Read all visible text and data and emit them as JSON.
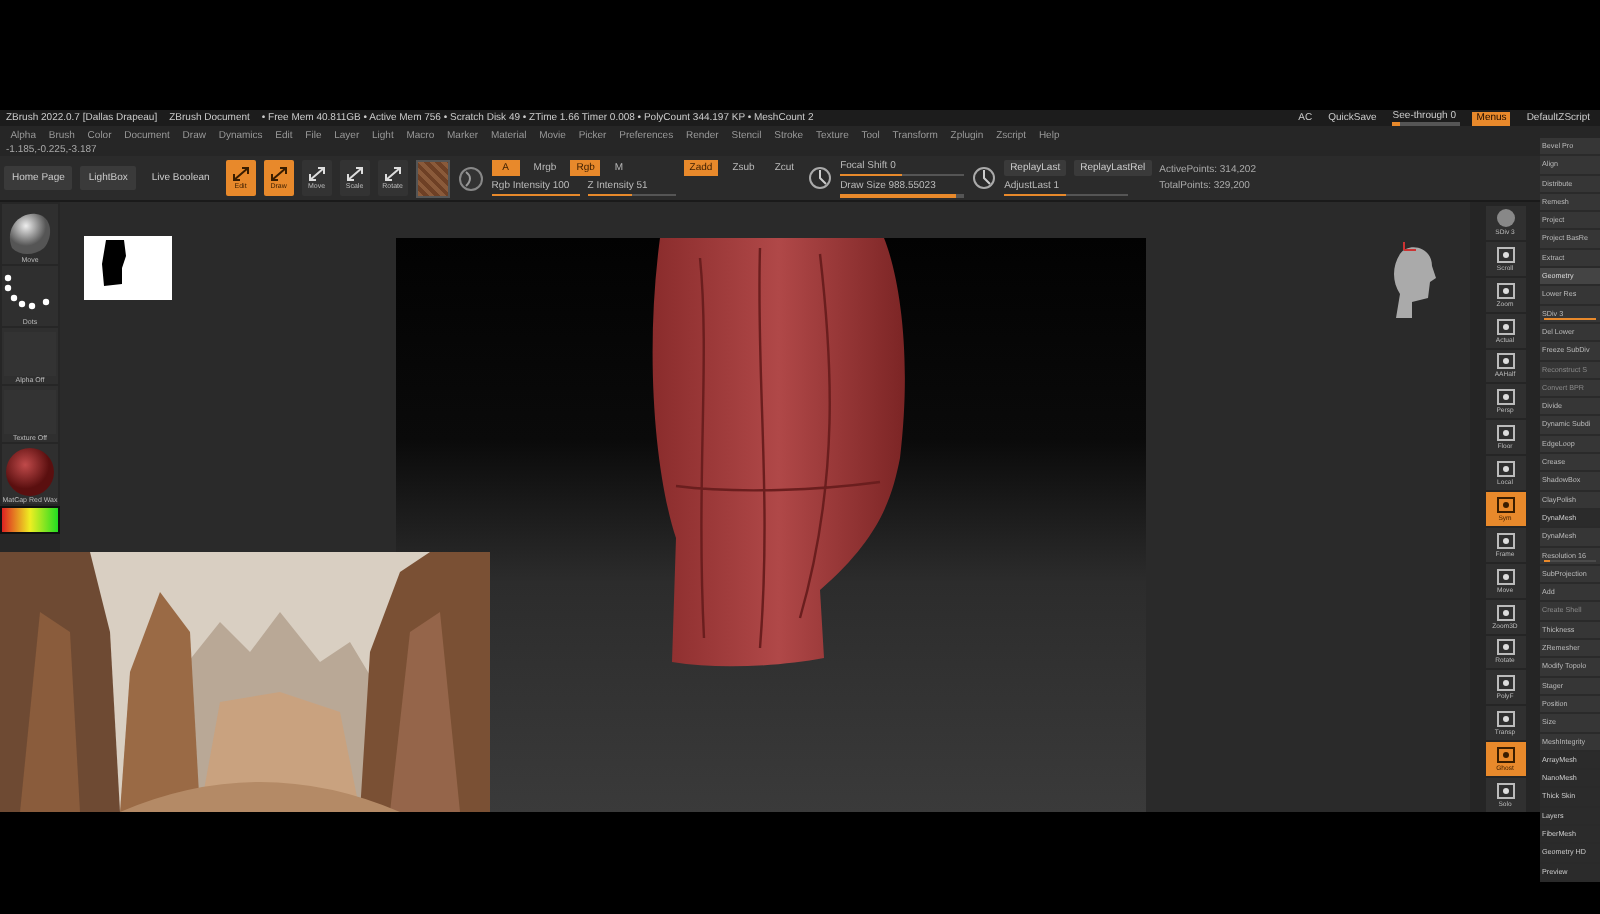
{
  "title_bar": {
    "app": "ZBrush 2022.0.7 [Dallas Drapeau]",
    "document": "ZBrush Document",
    "stats": "• Free Mem 40.811GB • Active Mem 756 • Scratch Disk 49 • ZTime 1.66 Timer 0.008 • PolyCount 344.197 KP • MeshCount 2",
    "ac": "AC",
    "quick_save": "QuickSave",
    "see_through": {
      "label": "See-through  0",
      "level": 0.1
    },
    "menus": {
      "label": "Menus",
      "on": true
    },
    "script": "DefaultZScript"
  },
  "menu_bar": [
    "Alpha",
    "Brush",
    "Color",
    "Document",
    "Draw",
    "Dynamics",
    "Edit",
    "File",
    "Layer",
    "Light",
    "Macro",
    "Marker",
    "Material",
    "Movie",
    "Picker",
    "Preferences",
    "Render",
    "Stencil",
    "Stroke",
    "Texture",
    "Tool",
    "Transform",
    "Zplugin",
    "Zscript",
    "Help"
  ],
  "coordinates": "-1.185,-0.225,-3.187",
  "toolbar": {
    "buttons": [
      "Home Page",
      "LightBox",
      "Live Boolean"
    ],
    "modes": [
      {
        "label": "Edit",
        "selected": true
      },
      {
        "label": "Draw",
        "selected": true
      },
      {
        "label": "Move",
        "selected": false
      },
      {
        "label": "Scale",
        "selected": false
      },
      {
        "label": "Rotate",
        "selected": false
      }
    ],
    "color_modes": [
      {
        "label": "A",
        "selected": true
      },
      {
        "label": "Mrgb",
        "selected": false
      },
      {
        "label": "Rgb",
        "selected": true
      },
      {
        "label": "M",
        "selected": false
      }
    ],
    "z_modes": [
      {
        "label": "Zadd",
        "selected": true
      },
      {
        "label": "Zsub",
        "selected": false
      },
      {
        "label": "Zcut",
        "selected": false
      }
    ],
    "intensity": [
      {
        "label": "Rgb Intensity",
        "value": "100",
        "level": 1
      },
      {
        "label": "Z Intensity",
        "value": "51",
        "level": 0.51
      }
    ],
    "focal": [
      {
        "label": "Focal Shift",
        "value": "0",
        "level": 0.5
      },
      {
        "label": "Draw Size",
        "value": "988.55023",
        "level": 0.93
      }
    ],
    "replay": [
      "ReplayLast",
      "ReplayLastRel"
    ],
    "adjust": {
      "label": "AdjustLast",
      "value": "1",
      "level": 0.5
    },
    "points": [
      "ActivePoints: 314,202",
      "TotalPoints: 329,200"
    ]
  },
  "left_shelf": [
    {
      "label": "Move",
      "kind": "brush"
    },
    {
      "label": "Dots",
      "kind": "stroke"
    },
    {
      "label": "Alpha Off",
      "kind": "empty"
    },
    {
      "label": "Texture Off",
      "kind": "empty"
    },
    {
      "label": "MatCap Red Wax",
      "kind": "material"
    },
    {
      "kind": "color"
    }
  ],
  "right_shelf": [
    {
      "label": "SDiv 3",
      "kind": "sphere"
    },
    {
      "label": "Scroll",
      "kind": "icon"
    },
    {
      "label": "Zoom",
      "kind": "icon"
    },
    {
      "label": "Actual",
      "kind": "icon"
    },
    {
      "label": "AAHalf",
      "kind": "icon"
    },
    {
      "label": "Persp",
      "kind": "icon"
    },
    {
      "label": "Floor",
      "kind": "icon"
    },
    {
      "label": "Local",
      "kind": "icon"
    },
    {
      "label": "Sym",
      "kind": "active"
    },
    {
      "label": "Frame",
      "kind": "icon"
    },
    {
      "label": "Move",
      "kind": "icon"
    },
    {
      "label": "Zoom3D",
      "kind": "icon"
    },
    {
      "label": "Rotate",
      "kind": "icon"
    },
    {
      "label": "PolyF",
      "kind": "icon"
    },
    {
      "label": "Transp",
      "kind": "icon"
    },
    {
      "label": "Ghost",
      "kind": "active"
    },
    {
      "label": "Solo",
      "kind": "icon"
    }
  ],
  "right_tray": [
    {
      "label": "Bevel Pro",
      "kind": "button"
    },
    {
      "label": "Align",
      "kind": "button"
    },
    {
      "label": "Distribute",
      "kind": "button"
    },
    {
      "label": "Remesh",
      "kind": "button"
    },
    {
      "label": "Project",
      "kind": "button"
    },
    {
      "label": "Project BasRe",
      "kind": "button"
    },
    {
      "label": "Extract",
      "kind": "button"
    },
    {
      "label": "Geometry",
      "kind": "header"
    },
    {
      "label": "Lower Res",
      "kind": "button"
    },
    {
      "label": "SDiv 3",
      "kind": "slider",
      "level": 1
    },
    {
      "label": "Del Lower",
      "kind": "button"
    },
    {
      "label": "Freeze SubDiv",
      "kind": "button"
    },
    {
      "label": "Reconstruct S",
      "kind": "dim"
    },
    {
      "label": "Convert BPR",
      "kind": "dim"
    },
    {
      "label": "Divide",
      "kind": "button"
    },
    {
      "label": "Dynamic Subdi",
      "kind": "button"
    },
    {
      "label": "EdgeLoop",
      "kind": "button"
    },
    {
      "label": "Crease",
      "kind": "button"
    },
    {
      "label": "ShadowBox",
      "kind": "button"
    },
    {
      "label": "ClayPolish",
      "kind": "button"
    },
    {
      "label": "DynaMesh",
      "kind": "subheader"
    },
    {
      "label": "DynaMesh",
      "kind": "button"
    },
    {
      "label": "Resolution 16",
      "kind": "slider",
      "level": 0.12
    },
    {
      "label": "SubProjection",
      "kind": "button"
    },
    {
      "label": "Add",
      "kind": "button"
    },
    {
      "label": "Create Shell",
      "kind": "dim"
    },
    {
      "label": "Thickness",
      "kind": "button"
    },
    {
      "label": "ZRemesher",
      "kind": "button"
    },
    {
      "label": "Modify Topolo",
      "kind": "button"
    },
    {
      "label": "Stager",
      "kind": "button"
    },
    {
      "label": "Position",
      "kind": "button"
    },
    {
      "label": "Size",
      "kind": "button"
    },
    {
      "label": "MeshIntegrity",
      "kind": "button"
    },
    {
      "label": "ArrayMesh",
      "kind": "subheader"
    },
    {
      "label": "NanoMesh",
      "kind": "subheader"
    },
    {
      "label": "Thick Skin",
      "kind": "subheader"
    },
    {
      "label": "Layers",
      "kind": "subheader"
    },
    {
      "label": "FiberMesh",
      "kind": "subheader"
    },
    {
      "label": "Geometry HD",
      "kind": "subheader"
    },
    {
      "label": "Preview",
      "kind": "subheader"
    }
  ]
}
